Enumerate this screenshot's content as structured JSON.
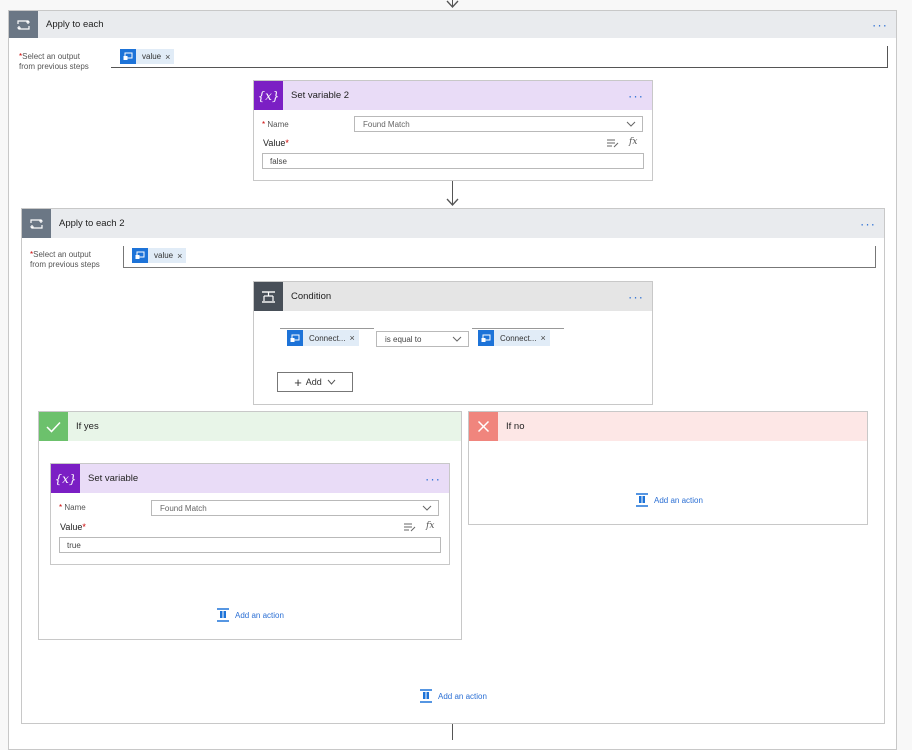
{
  "apply_each_1": {
    "title": "Apply to each",
    "select_label_line1": "Select an output",
    "select_label_line2": "from previous steps",
    "token": "value"
  },
  "set_variable_2": {
    "title": "Set variable 2",
    "name_label": "Name",
    "name_value": "Found Match",
    "value_label": "Value",
    "value": "false",
    "fx_label": "fx"
  },
  "apply_each_2": {
    "title": "Apply to each 2",
    "select_label_line1": "Select an output",
    "select_label_line2": "from previous steps",
    "token": "value"
  },
  "condition": {
    "title": "Condition",
    "left_token": "Connect...",
    "operator": "is equal to",
    "right_token": "Connect...",
    "add_label": "Add"
  },
  "if_yes": {
    "title": "If yes",
    "set_variable": {
      "title": "Set variable",
      "name_label": "Name",
      "name_value": "Found Match",
      "value_label": "Value",
      "value": "true",
      "fx_label": "fx"
    },
    "add_action": "Add an action"
  },
  "if_no": {
    "title": "If no",
    "add_action": "Add an action"
  },
  "apply_each_2_add_action": "Add an action",
  "colors": {
    "loop_header": "#e9ebee",
    "loop_icon": "#6b7785",
    "variable_header": "#e9dcf7",
    "variable_icon": "#7b1fc4",
    "condition_header": "#e5e5e5",
    "condition_icon": "#484f58",
    "yes_header": "#e8f5e8",
    "yes_icon": "#6cc16c",
    "no_header": "#fde7e6",
    "no_icon": "#f0857d",
    "accent": "#2b6fd4",
    "token_icon": "#1d73d8"
  }
}
